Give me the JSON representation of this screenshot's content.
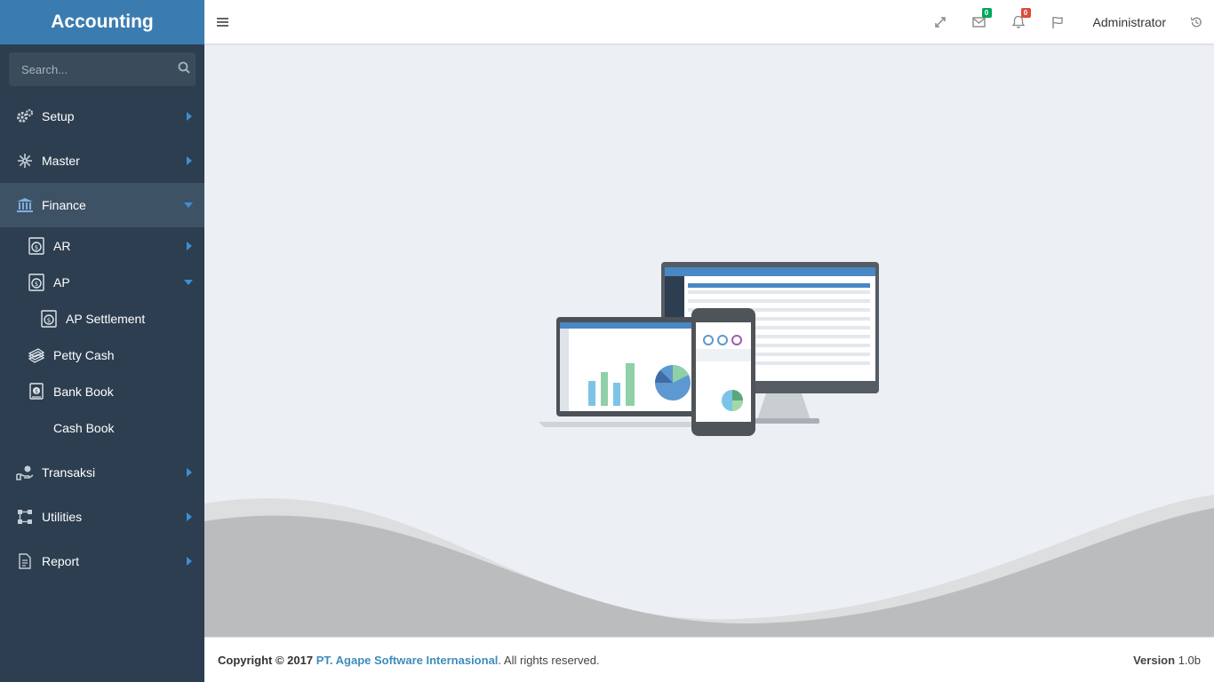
{
  "brand": {
    "title": "Accounting"
  },
  "search": {
    "placeholder": "Search..."
  },
  "sidebar": {
    "items": [
      {
        "label": "Setup",
        "icon": "gears-icon"
      },
      {
        "label": "Master",
        "icon": "snowflake-icon"
      },
      {
        "label": "Finance",
        "icon": "bank-icon",
        "expanded": true
      },
      {
        "label": "AR",
        "icon": "money-bag-icon"
      },
      {
        "label": "AP",
        "icon": "money-bag-icon",
        "expanded": true
      },
      {
        "label": "AP Settlement",
        "icon": "money-bag-icon"
      },
      {
        "label": "Petty Cash",
        "icon": "cash-stack-icon"
      },
      {
        "label": "Bank Book",
        "icon": "bank-book-icon"
      },
      {
        "label": "Cash Book",
        "icon": ""
      },
      {
        "label": "Transaksi",
        "icon": "hand-money-icon"
      },
      {
        "label": "Utilities",
        "icon": "sitemap-icon"
      },
      {
        "label": "Report",
        "icon": "report-icon"
      }
    ]
  },
  "topbar": {
    "messages_count": "0",
    "notifications_count": "0",
    "user": "Administrator"
  },
  "footer": {
    "copyright_prefix": "Copyright © 2017",
    "company": "PT. Agape Software Internasional",
    "rights": ". All rights reserved.",
    "version_label": "Version",
    "version_value": "1.0b"
  },
  "colors": {
    "sidebar_bg": "#2d3e50",
    "brand_bg": "#3b7cb0",
    "accent": "#3d8fd6",
    "badge_green": "#00a65a",
    "badge_red": "#dd4b39"
  }
}
